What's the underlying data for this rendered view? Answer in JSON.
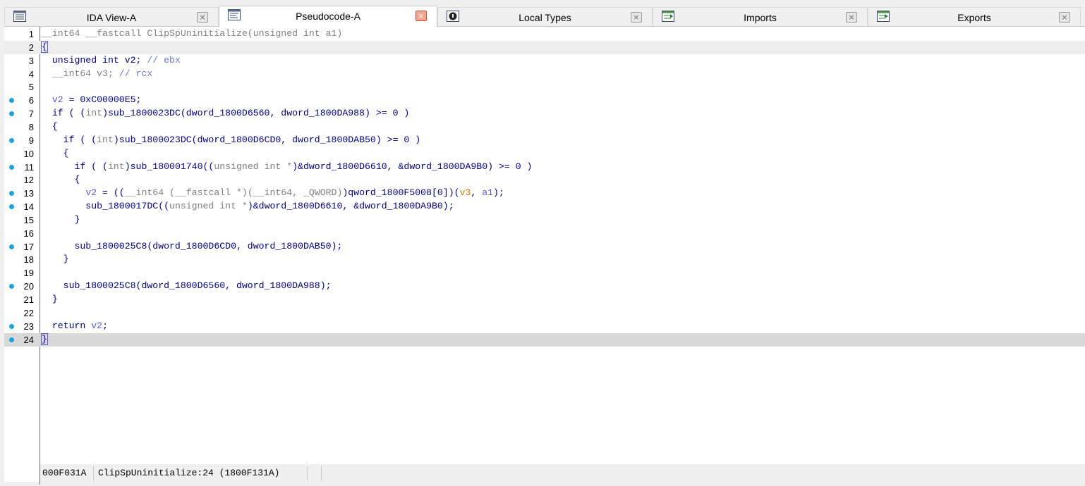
{
  "tabs": [
    {
      "label": "IDA View-A",
      "icon": "ida-view-icon",
      "close": "×",
      "active": false
    },
    {
      "label": "Pseudocode-A",
      "icon": "pseudocode-icon",
      "close": "×",
      "active": true
    },
    {
      "label": "Local Types",
      "icon": "local-types-icon",
      "close": "×",
      "active": false
    },
    {
      "label": "Imports",
      "icon": "imports-icon",
      "close": "×",
      "active": false
    },
    {
      "label": "Exports",
      "icon": "exports-icon",
      "close": "×",
      "active": false
    }
  ],
  "lines": [
    {
      "n": "1",
      "dot": false,
      "hl": "",
      "tokens": [
        [
          "__int64 __fastcall ClipSpUninitialize(unsigned int a1)",
          "gray"
        ]
      ]
    },
    {
      "n": "2",
      "dot": false,
      "hl": "light",
      "tokens": [
        [
          "{",
          "brace"
        ]
      ]
    },
    {
      "n": "3",
      "dot": false,
      "hl": "",
      "tokens": [
        [
          "  unsigned int v2; ",
          "kw"
        ],
        [
          "// ebx",
          "com"
        ]
      ]
    },
    {
      "n": "4",
      "dot": false,
      "hl": "",
      "tokens": [
        [
          "  __int64 v3; ",
          "gray"
        ],
        [
          "// rcx",
          "com"
        ]
      ]
    },
    {
      "n": "5",
      "dot": false,
      "hl": "",
      "tokens": [
        [
          "",
          "kw"
        ]
      ]
    },
    {
      "n": "6",
      "dot": true,
      "hl": "",
      "tokens": [
        [
          "  ",
          "kw"
        ],
        [
          "v2",
          "var"
        ],
        [
          " = 0xC00000E5;",
          "kw"
        ]
      ]
    },
    {
      "n": "7",
      "dot": true,
      "hl": "",
      "tokens": [
        [
          "  if ( (",
          "kw"
        ],
        [
          "int",
          "gray"
        ],
        [
          ")sub_1800023DC(dword_1800D6560, dword_1800DA988) >= 0 )",
          "kw"
        ]
      ]
    },
    {
      "n": "8",
      "dot": false,
      "hl": "",
      "tokens": [
        [
          "  {",
          "kw"
        ]
      ]
    },
    {
      "n": "9",
      "dot": true,
      "hl": "",
      "tokens": [
        [
          "    if ( (",
          "kw"
        ],
        [
          "int",
          "gray"
        ],
        [
          ")sub_1800023DC(dword_1800D6CD0, dword_1800DAB50) >= 0 )",
          "kw"
        ]
      ]
    },
    {
      "n": "10",
      "dot": false,
      "hl": "",
      "tokens": [
        [
          "    {",
          "kw"
        ]
      ]
    },
    {
      "n": "11",
      "dot": true,
      "hl": "",
      "tokens": [
        [
          "      if ( (",
          "kw"
        ],
        [
          "int",
          "gray"
        ],
        [
          ")sub_180001740((",
          "kw"
        ],
        [
          "unsigned int *",
          "gray"
        ],
        [
          ")&dword_1800D6610, &dword_1800DA9B0) >= 0 )",
          "kw"
        ]
      ]
    },
    {
      "n": "12",
      "dot": false,
      "hl": "",
      "tokens": [
        [
          "      {",
          "kw"
        ]
      ]
    },
    {
      "n": "13",
      "dot": true,
      "hl": "",
      "tokens": [
        [
          "        ",
          "kw"
        ],
        [
          "v2",
          "var"
        ],
        [
          " = ((",
          "kw"
        ],
        [
          "__int64 (__fastcall *)(__int64, _QWORD)",
          "gray"
        ],
        [
          ")qword_1800F5008[0])(",
          "kw"
        ],
        [
          "v3",
          "orange"
        ],
        [
          ", ",
          "kw"
        ],
        [
          "a1",
          "var"
        ],
        [
          ");",
          "kw"
        ]
      ]
    },
    {
      "n": "14",
      "dot": true,
      "hl": "",
      "tokens": [
        [
          "        sub_1800017DC((",
          "kw"
        ],
        [
          "unsigned int *",
          "gray"
        ],
        [
          ")&dword_1800D6610, &dword_1800DA9B0);",
          "kw"
        ]
      ]
    },
    {
      "n": "15",
      "dot": false,
      "hl": "",
      "tokens": [
        [
          "      }",
          "kw"
        ]
      ]
    },
    {
      "n": "16",
      "dot": false,
      "hl": "",
      "tokens": [
        [
          "",
          "kw"
        ]
      ]
    },
    {
      "n": "17",
      "dot": true,
      "hl": "",
      "tokens": [
        [
          "      sub_1800025C8(dword_1800D6CD0, dword_1800DAB50);",
          "kw"
        ]
      ]
    },
    {
      "n": "18",
      "dot": false,
      "hl": "",
      "tokens": [
        [
          "    }",
          "kw"
        ]
      ]
    },
    {
      "n": "19",
      "dot": false,
      "hl": "",
      "tokens": [
        [
          "",
          "kw"
        ]
      ]
    },
    {
      "n": "20",
      "dot": true,
      "hl": "",
      "tokens": [
        [
          "    sub_1800025C8(dword_1800D6560, dword_1800DA988);",
          "kw"
        ]
      ]
    },
    {
      "n": "21",
      "dot": false,
      "hl": "",
      "tokens": [
        [
          "  }",
          "kw"
        ]
      ]
    },
    {
      "n": "22",
      "dot": false,
      "hl": "",
      "tokens": [
        [
          "",
          "kw"
        ]
      ]
    },
    {
      "n": "23",
      "dot": true,
      "hl": "",
      "tokens": [
        [
          "  return ",
          "kw"
        ],
        [
          "v2",
          "var"
        ],
        [
          ";",
          "kw"
        ]
      ]
    },
    {
      "n": "24",
      "dot": true,
      "hl": "dark",
      "tokens": [
        [
          "}",
          "brace"
        ]
      ]
    }
  ],
  "status": {
    "offset": "000F031A",
    "location": "ClipSpUninitialize:24 (1800F131A)"
  },
  "colors": {
    "breakpoint_dot": "#1aa3e0",
    "keyword": "#000080",
    "type_gray": "#808080",
    "variable": "#5a5ad0",
    "comment": "#6a78d6",
    "active_close": "#f4a58f"
  }
}
